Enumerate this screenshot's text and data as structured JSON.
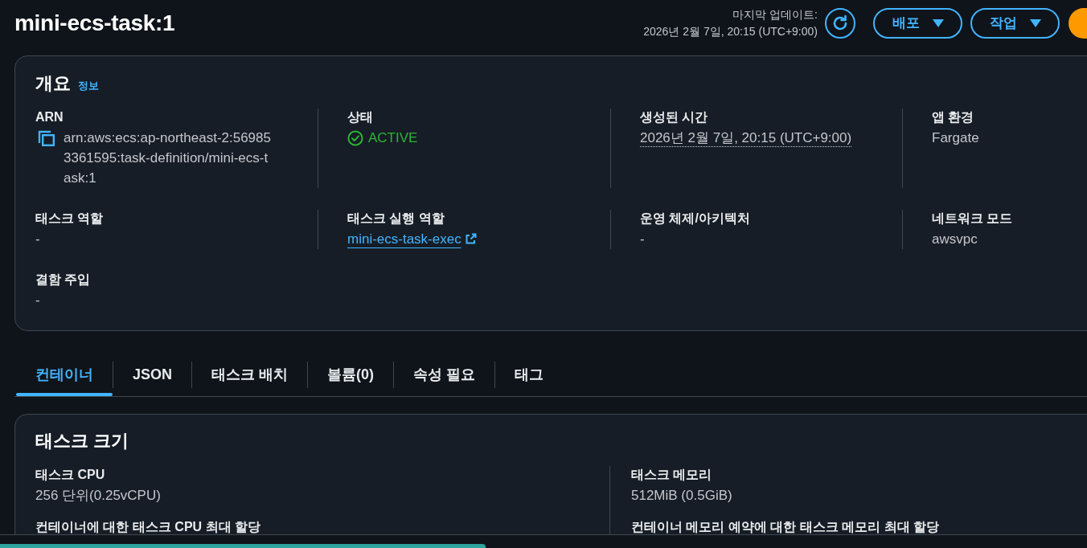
{
  "header": {
    "title": "mini-ecs-task:1",
    "last_updated_label": "마지막 업데이트:",
    "last_updated": "2026년 2월 7일, 20:15 (UTC+9:00)",
    "buttons": [
      {
        "kind": "refresh"
      },
      {
        "kind": "dropdown",
        "label": "배포"
      },
      {
        "kind": "dropdown",
        "label": "작업"
      },
      {
        "kind": "primary"
      }
    ]
  },
  "overview": {
    "title": "개요",
    "info_link": "정보",
    "fields": [
      {
        "kind": "copyable",
        "label": "ARN",
        "value": "arn:aws:ecs:ap-northeast-2:569853361595:task-definition/mini-ecs-task:1"
      },
      {
        "kind": "status",
        "label": "상태",
        "value": "ACTIVE"
      },
      {
        "kind": "timestamp",
        "label": "생성된 시간",
        "value": "2026년 2월 7일, 20:15 (UTC+9:00)"
      },
      {
        "kind": "text",
        "label": "앱 환경",
        "value": "Fargate"
      },
      {
        "kind": "text",
        "label": "태스크 역할",
        "value": "-"
      },
      {
        "kind": "external_link",
        "label": "태스크 실행 역할",
        "value": "mini-ecs-task-exec"
      },
      {
        "kind": "text",
        "label": "운영 체제/아키텍처",
        "value": "-"
      },
      {
        "kind": "text",
        "label": "네트워크 모드",
        "value": "awsvpc"
      },
      {
        "kind": "text",
        "label": "결함 주입",
        "value": "-"
      }
    ]
  },
  "tabs": [
    {
      "label": "컨테이너",
      "selected": true
    },
    {
      "label": "JSON",
      "selected": false
    },
    {
      "label": "태스크 배치",
      "selected": false
    },
    {
      "label": "볼륨(0)",
      "selected": false
    },
    {
      "label": "속성 필요",
      "selected": false
    },
    {
      "label": "태그",
      "selected": false
    }
  ],
  "task_size": {
    "title": "태스크 크기",
    "columns": [
      {
        "fields": [
          {
            "label": "태스크 CPU",
            "value": "256 단위(0.25vCPU)"
          },
          {
            "label": "컨테이너에 대한 태스크 CPU 최대 할당"
          }
        ]
      },
      {
        "fields": [
          {
            "label": "태스크 메모리",
            "value": "512MiB (0.5GiB)"
          },
          {
            "label": "컨테이너 메모리 예약에 대한 태스크 메모리 최대 할당"
          }
        ]
      }
    ]
  }
}
